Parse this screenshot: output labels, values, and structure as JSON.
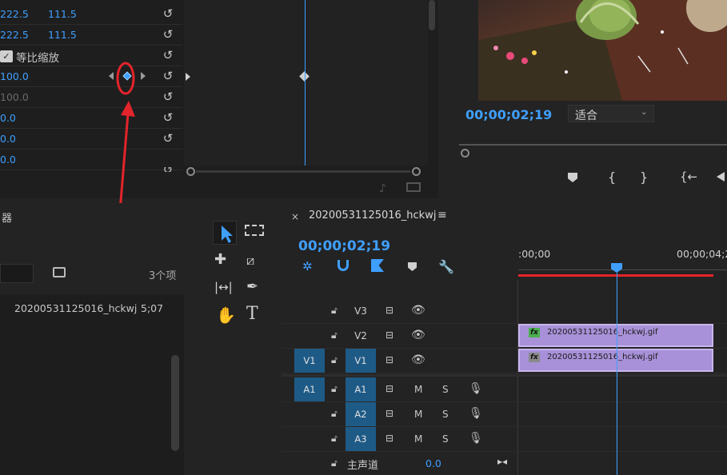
{
  "effect_controls": {
    "rows": [
      {
        "value": "222.5",
        "value2": "111.5"
      },
      {
        "value": "222.5",
        "value2": "111.5"
      },
      {
        "checkbox_label": "等比缩放"
      },
      {
        "value": "100.0"
      },
      {
        "value": "100.0"
      },
      {
        "value": "0.0"
      },
      {
        "value": "0.0"
      },
      {
        "value": "0.0"
      }
    ]
  },
  "program_monitor": {
    "timecode": "00;00;02;19",
    "zoom_select": "适合"
  },
  "project": {
    "title_partial": "器",
    "item_count": "3个项",
    "item_name": "20200531125016_hckwj",
    "item_duration": "5;07"
  },
  "timeline": {
    "tab_title": "20200531125016_hckwj",
    "timecode": "00;00;02;19",
    "ruler_start": ":00;00",
    "ruler_mark": "00;00;04;2",
    "tracks": {
      "v3": "V3",
      "v2": "V2",
      "v1": "V1",
      "v1_source": "V1",
      "a1": "A1",
      "a1_source": "A1",
      "a2": "A2",
      "a3": "A3",
      "mute": "M",
      "solo": "S"
    },
    "master_label": "主声道",
    "master_value": "0.0",
    "clips": {
      "v2_clip": "20200531125016_hckwj.gif",
      "v1_clip": "20200531125016_hckwj.gif",
      "fx": "fx"
    }
  },
  "colors": {
    "accent_blue": "#3f9fff",
    "clip_purple": "#a891d8",
    "track_blue": "#1e5a86",
    "annotation_red": "#e3242b"
  }
}
